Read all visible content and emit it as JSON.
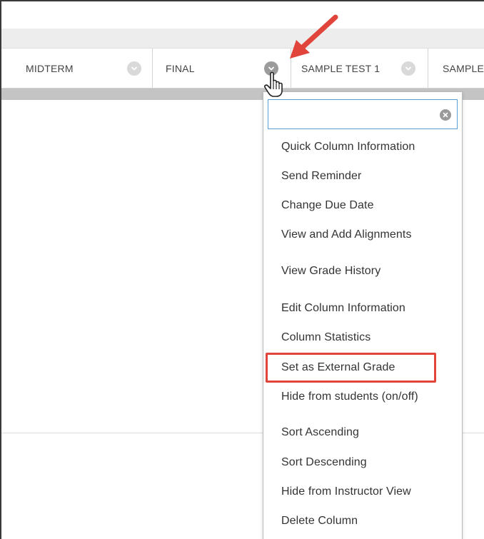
{
  "grade_center": {
    "columns": [
      {
        "label": "MIDTERM"
      },
      {
        "label": "FINAL"
      },
      {
        "label": "SAMPLE TEST 1"
      },
      {
        "label": "SAMPLE"
      }
    ]
  },
  "context_menu": {
    "search": {
      "placeholder": "",
      "value": ""
    },
    "items": [
      {
        "label": "Quick Column Information"
      },
      {
        "label": "Send Reminder"
      },
      {
        "label": "Change Due Date"
      },
      {
        "label": "View and Add Alignments"
      },
      {
        "label": "View Grade History"
      },
      {
        "label": "Edit Column Information"
      },
      {
        "label": "Column Statistics"
      },
      {
        "label": "Set as External Grade"
      },
      {
        "label": "Hide from students (on/off)"
      },
      {
        "label": "Sort Ascending"
      },
      {
        "label": "Sort Descending"
      },
      {
        "label": "Hide from Instructor View"
      },
      {
        "label": "Delete Column"
      }
    ]
  },
  "colors": {
    "highlight": "#e0443a",
    "arrow": "#e0443a",
    "search_border": "#5aa0d6"
  }
}
